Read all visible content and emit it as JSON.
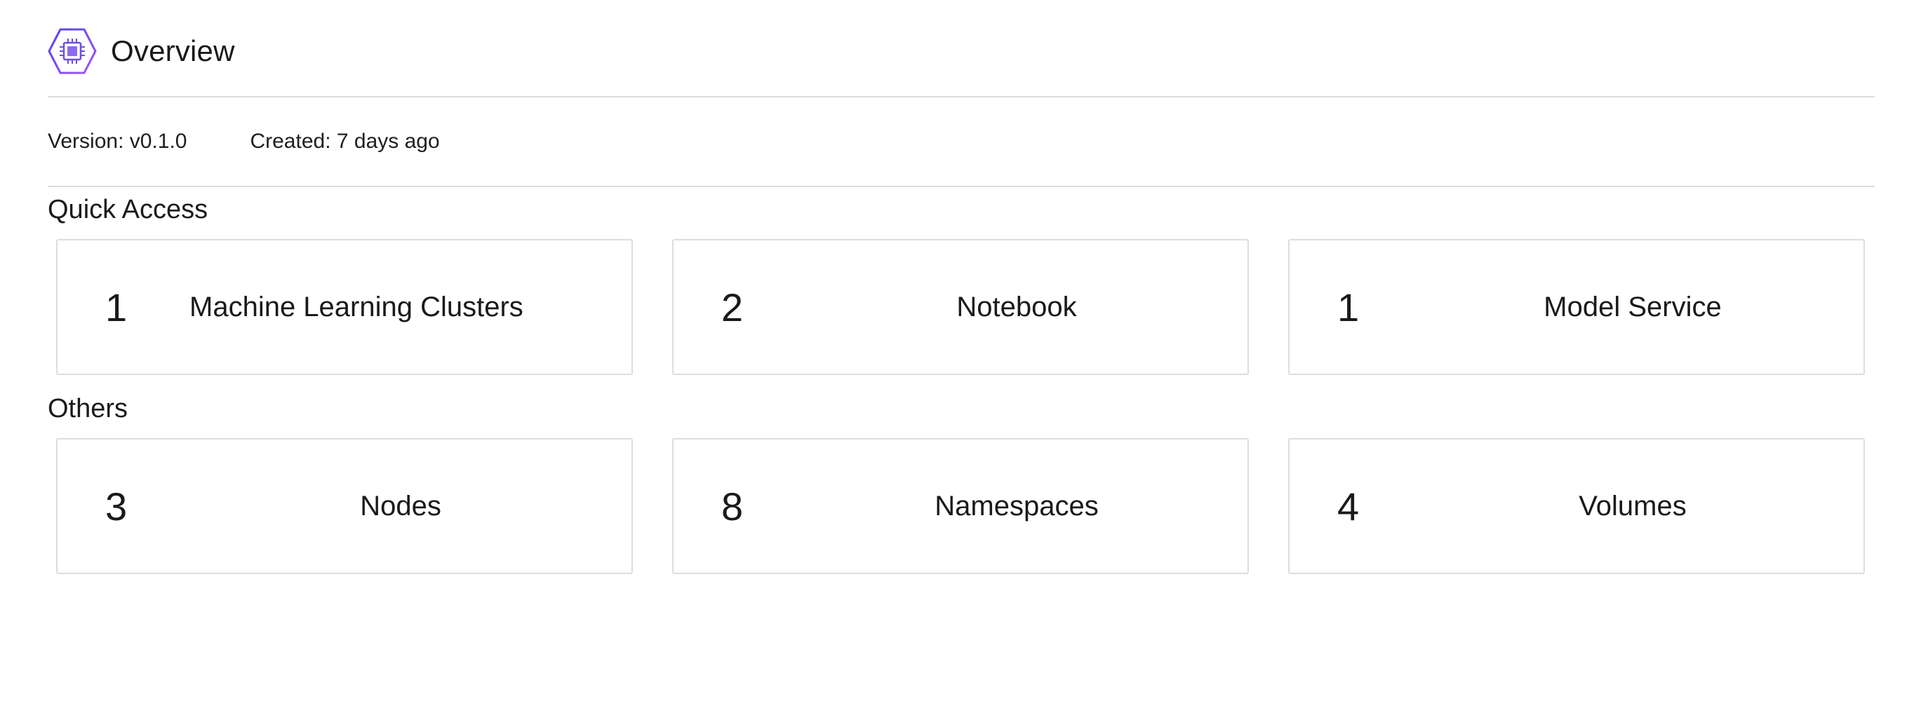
{
  "header": {
    "title": "Overview",
    "icon": "chip-icon"
  },
  "meta": {
    "version": "Version: v0.1.0",
    "created": "Created: 7 days ago"
  },
  "quick_access": {
    "title": "Quick Access",
    "cards": [
      {
        "count": "1",
        "label": "Machine Learning Clusters"
      },
      {
        "count": "2",
        "label": "Notebook"
      },
      {
        "count": "1",
        "label": "Model Service"
      }
    ]
  },
  "others": {
    "title": "Others",
    "cards": [
      {
        "count": "3",
        "label": "Nodes"
      },
      {
        "count": "8",
        "label": "Namespaces"
      },
      {
        "count": "4",
        "label": "Volumes"
      }
    ]
  },
  "colors": {
    "icon_gradient_start": "#4f46e5",
    "icon_gradient_end": "#a855f7",
    "divider": "#dcdcdc",
    "card_border": "#dddddd"
  }
}
